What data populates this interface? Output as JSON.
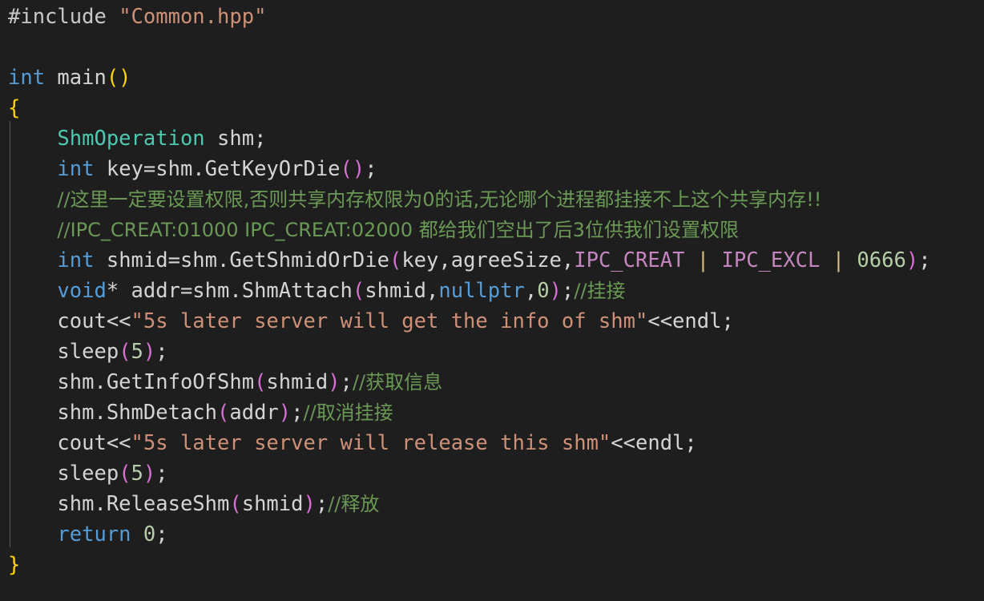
{
  "editor": {
    "language": "cpp",
    "background_color": "#1e1e1e",
    "default_text_color": "#d4d4d4",
    "indent_guide_color": "#5a5a5a",
    "font_size_px": 25,
    "line_height_px": 38,
    "theme_colors": {
      "preprocessor": "#c8c8c8",
      "string": "#ce9178",
      "keyword": "#569cd6",
      "type": "#4ec9b0",
      "number": "#b5cea8",
      "comment": "#6a9955",
      "macro": "#c586c0",
      "bracket_yellow": "#ffd700",
      "bracket_magenta": "#da70d6",
      "operator_yellow": "#d7ba7d"
    }
  },
  "code": {
    "lines": [
      {
        "id": 1,
        "tokens": [
          {
            "t": "#include",
            "c": "t-pre"
          },
          {
            "t": " ",
            "c": "t-punct"
          },
          {
            "t": "\"Common.hpp\"",
            "c": "t-str"
          }
        ]
      },
      {
        "id": 2,
        "tokens": []
      },
      {
        "id": 3,
        "tokens": [
          {
            "t": "int",
            "c": "t-kw"
          },
          {
            "t": " main",
            "c": "t-id"
          },
          {
            "t": "()",
            "c": "t-br-y"
          }
        ]
      },
      {
        "id": 4,
        "tokens": [
          {
            "t": "{",
            "c": "t-br-y"
          }
        ]
      },
      {
        "id": 5,
        "tokens": [
          {
            "t": "    ",
            "c": "t-punct"
          },
          {
            "t": "ShmOperation",
            "c": "t-type"
          },
          {
            "t": " shm;",
            "c": "t-id"
          }
        ]
      },
      {
        "id": 6,
        "tokens": [
          {
            "t": "    ",
            "c": "t-punct"
          },
          {
            "t": "int",
            "c": "t-kw"
          },
          {
            "t": " key=shm.GetKeyOrDie",
            "c": "t-id"
          },
          {
            "t": "()",
            "c": "t-br-m"
          },
          {
            "t": ";",
            "c": "t-punct"
          }
        ]
      },
      {
        "id": 7,
        "tokens": [
          {
            "t": "    ",
            "c": "t-punct"
          },
          {
            "t": "//这里一定要设置权限,否则共享内存权限为0的话,无论哪个进程都挂接不上这个共享内存!!",
            "c": "t-cmt"
          }
        ]
      },
      {
        "id": 8,
        "tokens": [
          {
            "t": "    ",
            "c": "t-punct"
          },
          {
            "t": "//IPC_CREAT:01000 IPC_CREAT:02000 都给我们空出了后3位供我们设置权限",
            "c": "t-cmt"
          }
        ]
      },
      {
        "id": 9,
        "tokens": [
          {
            "t": "    ",
            "c": "t-punct"
          },
          {
            "t": "int",
            "c": "t-kw"
          },
          {
            "t": " shmid=shm.GetShmidOrDie",
            "c": "t-id"
          },
          {
            "t": "(",
            "c": "t-br-m"
          },
          {
            "t": "key,agreeSize,",
            "c": "t-id"
          },
          {
            "t": "IPC_CREAT",
            "c": "t-macro"
          },
          {
            "t": " ",
            "c": "t-punct"
          },
          {
            "t": "|",
            "c": "t-op-y"
          },
          {
            "t": " ",
            "c": "t-punct"
          },
          {
            "t": "IPC_EXCL",
            "c": "t-macro"
          },
          {
            "t": " ",
            "c": "t-punct"
          },
          {
            "t": "|",
            "c": "t-op-y"
          },
          {
            "t": " ",
            "c": "t-punct"
          },
          {
            "t": "0666",
            "c": "t-num"
          },
          {
            "t": ")",
            "c": "t-br-m"
          },
          {
            "t": ";",
            "c": "t-punct"
          }
        ]
      },
      {
        "id": 10,
        "tokens": [
          {
            "t": "    ",
            "c": "t-punct"
          },
          {
            "t": "void",
            "c": "t-kw"
          },
          {
            "t": "* addr=shm.ShmAttach",
            "c": "t-id"
          },
          {
            "t": "(",
            "c": "t-br-m"
          },
          {
            "t": "shmid,",
            "c": "t-id"
          },
          {
            "t": "nullptr",
            "c": "t-kw"
          },
          {
            "t": ",",
            "c": "t-id"
          },
          {
            "t": "0",
            "c": "t-num"
          },
          {
            "t": ")",
            "c": "t-br-m"
          },
          {
            "t": ";",
            "c": "t-punct"
          },
          {
            "t": "//挂接",
            "c": "t-cmt"
          }
        ]
      },
      {
        "id": 11,
        "tokens": [
          {
            "t": "    ",
            "c": "t-punct"
          },
          {
            "t": "cout<<",
            "c": "t-id"
          },
          {
            "t": "\"5s later server will get the info of shm\"",
            "c": "t-str"
          },
          {
            "t": "<<endl;",
            "c": "t-id"
          }
        ]
      },
      {
        "id": 12,
        "tokens": [
          {
            "t": "    ",
            "c": "t-punct"
          },
          {
            "t": "sleep",
            "c": "t-id"
          },
          {
            "t": "(",
            "c": "t-br-m"
          },
          {
            "t": "5",
            "c": "t-num"
          },
          {
            "t": ")",
            "c": "t-br-m"
          },
          {
            "t": ";",
            "c": "t-punct"
          }
        ]
      },
      {
        "id": 13,
        "tokens": [
          {
            "t": "    ",
            "c": "t-punct"
          },
          {
            "t": "shm.GetInfoOfShm",
            "c": "t-id"
          },
          {
            "t": "(",
            "c": "t-br-m"
          },
          {
            "t": "shmid",
            "c": "t-id"
          },
          {
            "t": ")",
            "c": "t-br-m"
          },
          {
            "t": ";",
            "c": "t-punct"
          },
          {
            "t": "//获取信息",
            "c": "t-cmt"
          }
        ]
      },
      {
        "id": 14,
        "tokens": [
          {
            "t": "    ",
            "c": "t-punct"
          },
          {
            "t": "shm.ShmDetach",
            "c": "t-id"
          },
          {
            "t": "(",
            "c": "t-br-m"
          },
          {
            "t": "addr",
            "c": "t-id"
          },
          {
            "t": ")",
            "c": "t-br-m"
          },
          {
            "t": ";",
            "c": "t-punct"
          },
          {
            "t": "//取消挂接",
            "c": "t-cmt"
          }
        ]
      },
      {
        "id": 15,
        "tokens": [
          {
            "t": "    ",
            "c": "t-punct"
          },
          {
            "t": "cout<<",
            "c": "t-id"
          },
          {
            "t": "\"5s later server will release this shm\"",
            "c": "t-str"
          },
          {
            "t": "<<endl;",
            "c": "t-id"
          }
        ]
      },
      {
        "id": 16,
        "tokens": [
          {
            "t": "    ",
            "c": "t-punct"
          },
          {
            "t": "sleep",
            "c": "t-id"
          },
          {
            "t": "(",
            "c": "t-br-m"
          },
          {
            "t": "5",
            "c": "t-num"
          },
          {
            "t": ")",
            "c": "t-br-m"
          },
          {
            "t": ";",
            "c": "t-punct"
          }
        ]
      },
      {
        "id": 17,
        "tokens": [
          {
            "t": "    ",
            "c": "t-punct"
          },
          {
            "t": "shm.ReleaseShm",
            "c": "t-id"
          },
          {
            "t": "(",
            "c": "t-br-m"
          },
          {
            "t": "shmid",
            "c": "t-id"
          },
          {
            "t": ")",
            "c": "t-br-m"
          },
          {
            "t": ";",
            "c": "t-punct"
          },
          {
            "t": "//释放",
            "c": "t-cmt"
          }
        ]
      },
      {
        "id": 18,
        "tokens": [
          {
            "t": "    ",
            "c": "t-punct"
          },
          {
            "t": "return",
            "c": "t-kw"
          },
          {
            "t": " ",
            "c": "t-punct"
          },
          {
            "t": "0",
            "c": "t-num"
          },
          {
            "t": ";",
            "c": "t-punct"
          }
        ]
      },
      {
        "id": 19,
        "tokens": [
          {
            "t": "}",
            "c": "t-br-y"
          }
        ]
      }
    ]
  }
}
